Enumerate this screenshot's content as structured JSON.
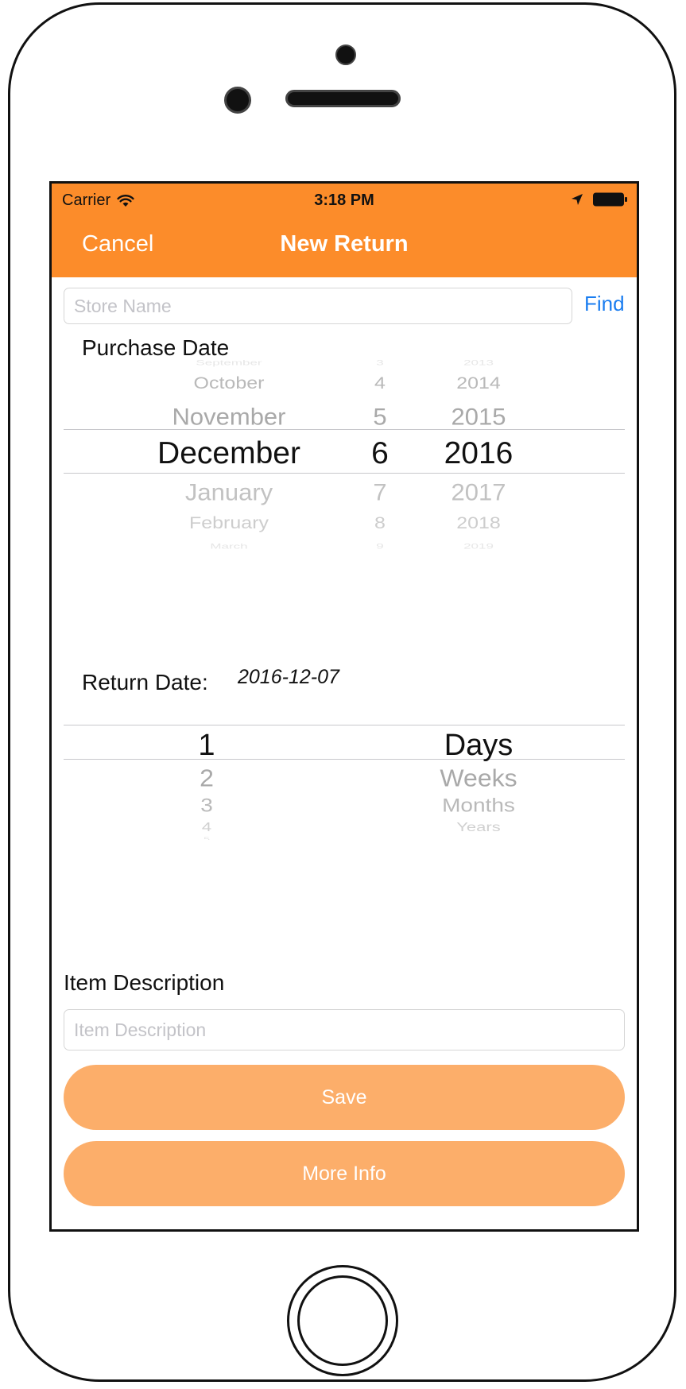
{
  "status_bar": {
    "carrier": "Carrier",
    "time": "3:18 PM"
  },
  "nav": {
    "cancel_label": "Cancel",
    "title": "New Return"
  },
  "store": {
    "placeholder": "Store Name",
    "find_label": "Find"
  },
  "purchase": {
    "label": "Purchase Date",
    "months": [
      "September",
      "October",
      "November",
      "December",
      "January",
      "February",
      "March"
    ],
    "days": [
      "3",
      "4",
      "5",
      "6",
      "7",
      "8",
      "9"
    ],
    "years": [
      "2013",
      "2014",
      "2015",
      "2016",
      "2017",
      "2018",
      "2019"
    ],
    "selected_month": "December",
    "selected_day": "6",
    "selected_year": "2016"
  },
  "return": {
    "label": "Return Date:",
    "value": "2016-12-07"
  },
  "duration": {
    "numbers": [
      "1",
      "2",
      "3",
      "4",
      "5"
    ],
    "units": [
      "Days",
      "Weeks",
      "Months",
      "Years"
    ],
    "selected_number": "1",
    "selected_unit": "Days"
  },
  "item": {
    "label": "Item Description",
    "placeholder": "Item Description"
  },
  "buttons": {
    "save_label": "Save",
    "more_info_label": "More Info"
  },
  "colors": {
    "nav_bar": "#fc8c2a",
    "button": "#fcae6a",
    "link": "#1a7df0"
  }
}
